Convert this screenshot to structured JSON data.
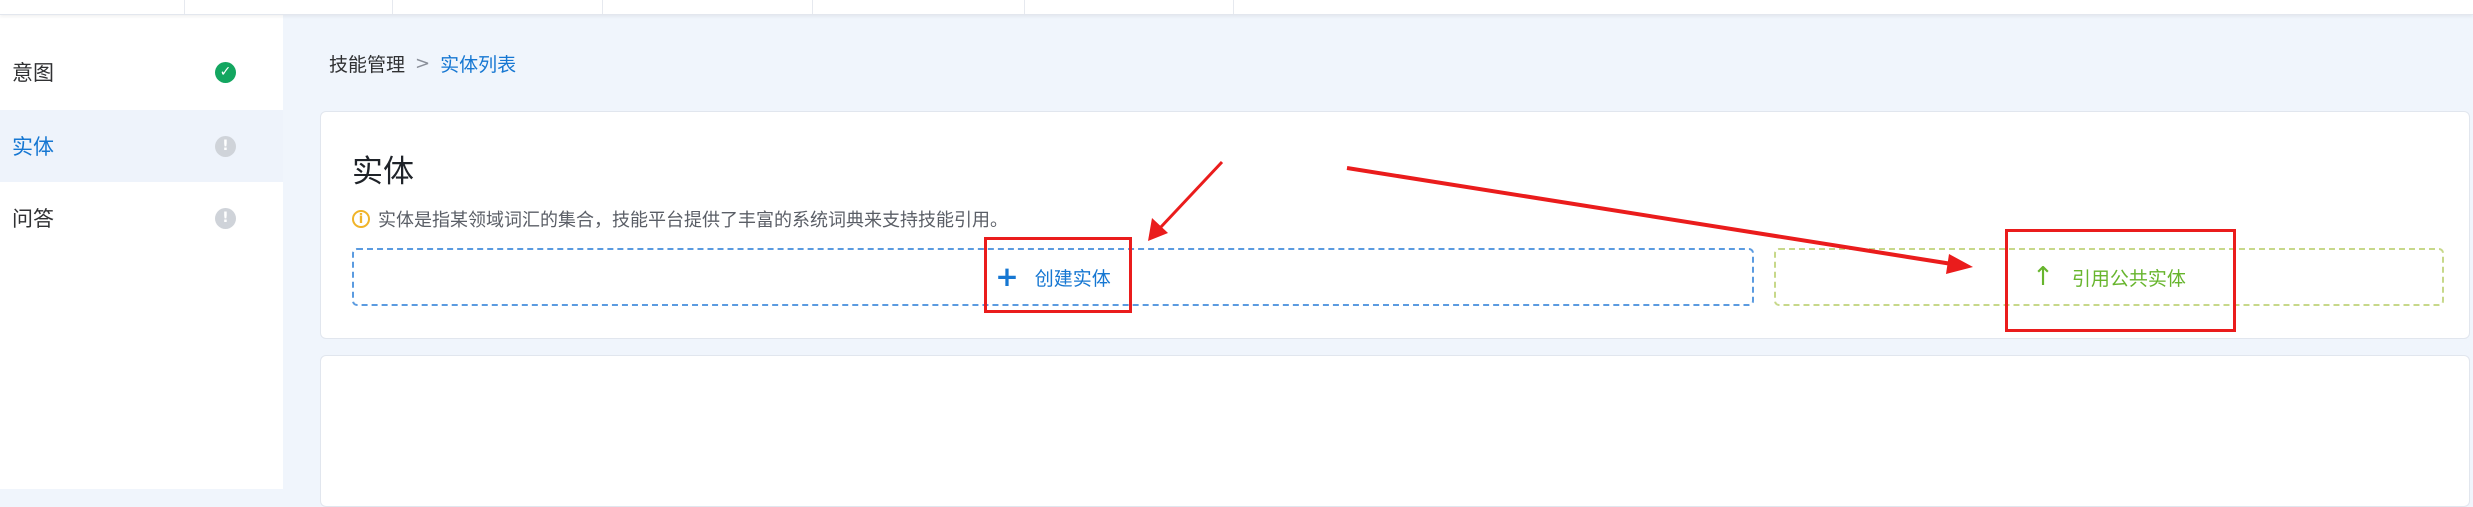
{
  "sidebar": {
    "items": [
      {
        "label": "意图",
        "status": "done"
      },
      {
        "label": "实体",
        "status": "pending"
      },
      {
        "label": "问答",
        "status": "pending"
      }
    ]
  },
  "breadcrumb": {
    "parent": "技能管理",
    "separator": ">",
    "current": "实体列表"
  },
  "main": {
    "title": "实体",
    "hint_icon": "i",
    "hint": "实体是指某领域词汇的集合，技能平台提供了丰富的系统词典来支持技能引用。",
    "create_button": {
      "icon": "plus-icon",
      "glyph": "+",
      "label": "创建实体"
    },
    "reference_button": {
      "icon": "arrow-up-icon",
      "glyph": "↑",
      "label": "引用公共实体"
    }
  },
  "colors": {
    "accent": "#1677d2",
    "success": "#13a660",
    "reference": "#67b52d",
    "annotation": "#ea1c1c"
  }
}
